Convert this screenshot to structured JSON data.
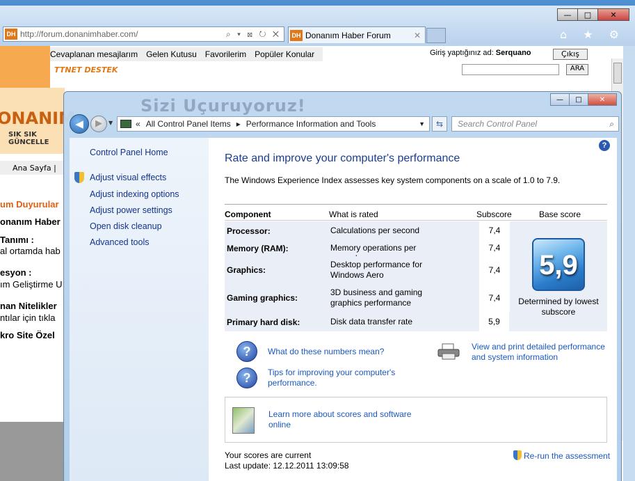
{
  "browser": {
    "url": "http://forum.donanimhaber.com/",
    "favicon": "DH",
    "addr_controls": "⌕ ▾ ⊠ ↻ ✕",
    "tab_label": "Donanım Haber Forum",
    "tab_close": "✕",
    "win_min": "—",
    "win_max": "□",
    "win_close": "✕",
    "tool_icons": "⌂ ★ ⚙"
  },
  "forum": {
    "toolbar": [
      "Cevaplanan mesajlarım",
      "Gelen Kutusu",
      "Favorilerim",
      "Popüler Konular"
    ],
    "login_prefix": "Giriş yaptığınız ad:",
    "login_user": "Serquano",
    "logout": "Çıkış",
    "search_button": "ARA",
    "ttnet": "TTNET DESTEK",
    "logo_big": "ONANIM",
    "logo_small": "SIK SIK GÜNCELLE",
    "menu": "Ana Sayfa |",
    "lines": [
      "um Duyurular",
      "onanım Haber",
      "Tanımı :",
      "al ortamda hab",
      "esyon :",
      "ım Geliştirme U",
      "nan Nitelikler",
      "ntılar için tıkla",
      "kro Site Özel"
    ]
  },
  "control_panel": {
    "blur_title": "Sizi Uçuruyoruz!",
    "breadcrumb": [
      "«",
      "All Control Panel Items",
      "▸",
      "Performance Information and Tools"
    ],
    "search_placeholder": "Search Control Panel",
    "nav": {
      "home": "Control Panel Home",
      "items": [
        "Adjust visual effects",
        "Adjust indexing options",
        "Adjust power settings",
        "Open disk cleanup",
        "Advanced tools"
      ]
    },
    "title": "Rate and improve your computer's performance",
    "intro": "The Windows Experience Index assesses key system components on a scale of 1.0 to 7.9.",
    "columns": [
      "Component",
      "What is rated",
      "Subscore",
      "Base score"
    ],
    "rows": [
      {
        "component": "Processor:",
        "rated": "Calculations per second",
        "subscore": "7,4"
      },
      {
        "component": "Memory (RAM):",
        "rated": "Memory operations per second",
        "subscore": "7,4"
      },
      {
        "component": "Graphics:",
        "rated": "Desktop performance for Windows Aero",
        "subscore": "7,4"
      },
      {
        "component": "Gaming graphics:",
        "rated": "3D business and gaming graphics performance",
        "subscore": "7,4"
      },
      {
        "component": "Primary hard disk:",
        "rated": "Disk data transfer rate",
        "subscore": "5,9"
      }
    ],
    "base_score": "5,9",
    "base_caption": "Determined by lowest subscore",
    "links": {
      "numbers": "What do these numbers mean?",
      "tips": "Tips for improving your computer's performance.",
      "print": "View and print detailed performance and system information",
      "learn": "Learn more about scores and software online",
      "rerun": "Re-run the assessment"
    },
    "status": "Your scores are current",
    "last_update": "Last update: 12.12.2011 13:09:58"
  }
}
